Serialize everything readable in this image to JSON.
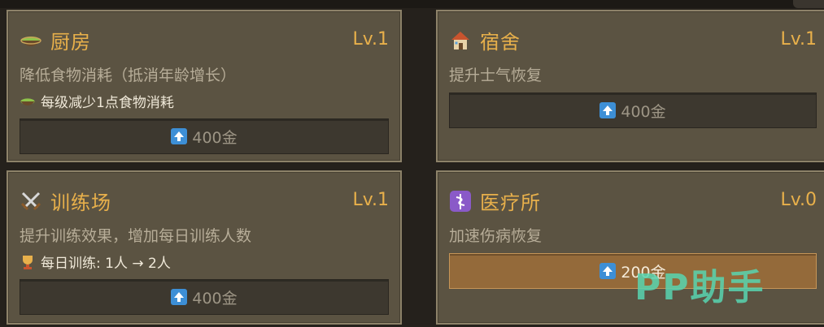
{
  "cards": [
    {
      "name": "厨房",
      "level": "Lv.1",
      "desc": "降低食物消耗（抵消年龄增长）",
      "effect": "每级减少1点食物消耗",
      "cost": "400金",
      "icon": "bowl-icon",
      "effect_icon": "bowl-icon"
    },
    {
      "name": "宿舍",
      "level": "Lv.1",
      "desc": "提升士气恢复",
      "cost": "400金",
      "icon": "house-icon"
    },
    {
      "name": "训练场",
      "level": "Lv.1",
      "desc": "提升训练效果，增加每日训练人数",
      "effect": "每日训练: 1人 → 2人",
      "cost": "400金",
      "icon": "crossed-swords-icon",
      "effect_icon": "trophy-icon"
    },
    {
      "name": "医疗所",
      "level": "Lv.0",
      "desc": "加速伤病恢复",
      "cost": "200金",
      "icon": "medical-icon",
      "upgrade_active": true
    }
  ],
  "watermark": "PP助手",
  "colors": {
    "title": "#e8b04b",
    "card_bg": "#5b5342",
    "button_disabled": "#3d382f",
    "button_active": "#946a3a",
    "upgrade_icon": "#3d8fd6",
    "watermark": "#58d5b0"
  }
}
